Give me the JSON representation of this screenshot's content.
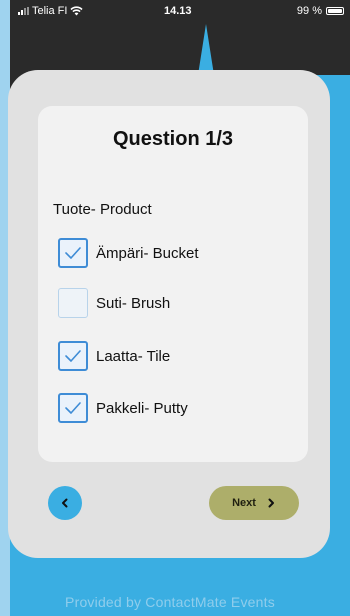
{
  "status_bar": {
    "carrier": "Telia FI",
    "time": "14.13",
    "battery": "99 %"
  },
  "quiz": {
    "title": "Question 1/3",
    "question": "Tuote- Product",
    "options": [
      {
        "label": "Ämpäri- Bucket",
        "checked": true
      },
      {
        "label": "Suti- Brush",
        "checked": false
      },
      {
        "label": "Laatta- Tile",
        "checked": true
      },
      {
        "label": "Pakkeli- Putty",
        "checked": true
      }
    ]
  },
  "navigation": {
    "next_label": "Next"
  },
  "footer": {
    "text": "Provided by ContactMate Events"
  },
  "colors": {
    "sky_blue": "#3aaee2",
    "dark_background": "#2a2a2a",
    "checkbox_accent": "#3e8cd6",
    "next_button": "#adae6a"
  }
}
